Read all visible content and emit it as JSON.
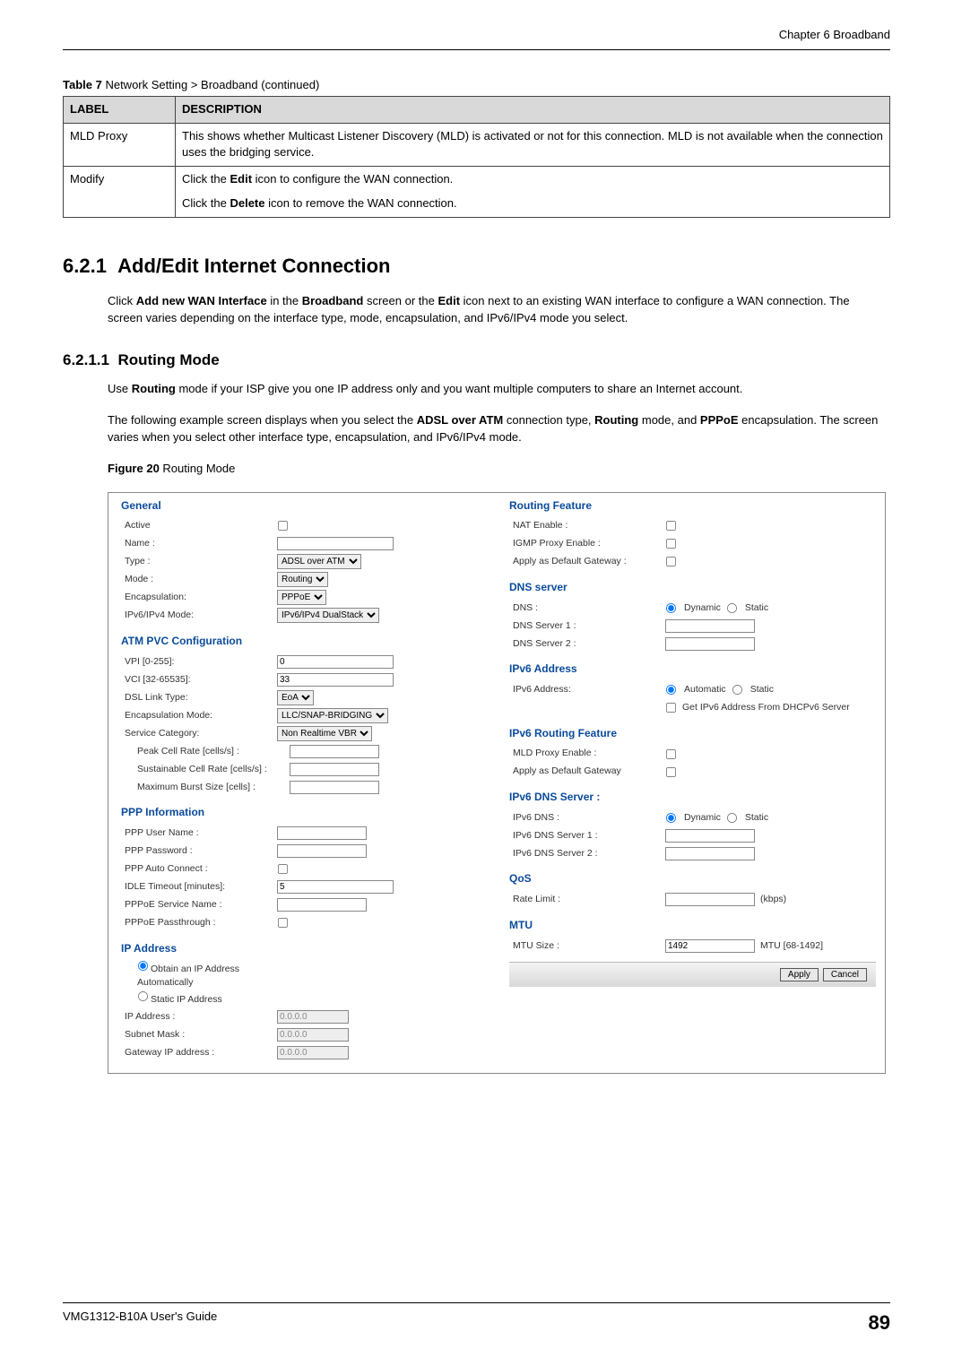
{
  "header": {
    "chapter": "Chapter 6 Broadband"
  },
  "table7": {
    "caption_bold": "Table 7",
    "caption_rest": "   Network Setting > Broadband (continued)",
    "head_label": "LABEL",
    "head_desc": "DESCRIPTION",
    "rows": [
      {
        "label": "MLD Proxy",
        "desc1": "This shows whether Multicast Listener Discovery (MLD) is activated or not for this connection. MLD is not available when the connection uses the bridging service."
      },
      {
        "label": "Modify",
        "desc1": "Click the Edit icon to configure the WAN connection.",
        "desc2": "Click the Delete icon to remove the WAN connection."
      }
    ]
  },
  "sec621": {
    "num": "6.2.1",
    "title": "Add/Edit Internet Connection",
    "para": "Click Add new WAN Interface in the Broadband screen or the Edit icon next to an existing WAN interface to configure a WAN connection. The screen varies depending on the interface type, mode, encapsulation, and IPv6/IPv4 mode you select."
  },
  "sec6211": {
    "num": "6.2.1.1",
    "title": "Routing Mode",
    "para1": "Use Routing mode if your ISP give you one IP address only and you want multiple computers to share an Internet account.",
    "para2": "The following example screen displays when you select the ADSL over ATM connection type, Routing mode, and PPPoE encapsulation. The screen varies when you select other interface type, encapsulation, and IPv6/IPv4 mode."
  },
  "figure": {
    "caption_bold": "Figure 20",
    "caption_rest": "   Routing Mode",
    "general": {
      "title": "General",
      "active": "Active",
      "name": "Name :",
      "type": "Type :",
      "type_v": "ADSL over ATM",
      "mode": "Mode :",
      "mode_v": "Routing",
      "encap": "Encapsulation:",
      "encap_v": "PPPoE",
      "ipmode": "IPv6/IPv4 Mode:",
      "ipmode_v": "IPv6/IPv4 DualStack"
    },
    "atm": {
      "title": "ATM PVC Configuration",
      "vpi": "VPI [0-255]:",
      "vpi_v": "0",
      "vci": "VCI [32-65535]:",
      "vci_v": "33",
      "link": "DSL Link Type:",
      "link_v": "EoA",
      "encmode": "Encapsulation Mode:",
      "encmode_v": "LLC/SNAP-BRIDGING",
      "service": "Service Category:",
      "service_v": "Non Realtime VBR",
      "peak": "Peak Cell Rate [cells/s] :",
      "sustain": "Sustainable Cell Rate [cells/s] :",
      "burst": "Maximum Burst Size [cells] :"
    },
    "ppp": {
      "title": "PPP Information",
      "user": "PPP User Name :",
      "pass": "PPP Password :",
      "auto": "PPP Auto Connect :",
      "idle": "IDLE Timeout [minutes]:",
      "idle_v": "5",
      "svcname": "PPPoE Service Name :",
      "pass_th": "PPPoE Passthrough :"
    },
    "ipaddr": {
      "title": "IP Address",
      "opt_auto": "Obtain an IP Address Automatically",
      "opt_static": "Static IP Address",
      "ip": "IP Address :",
      "ip_v": "0.0.0.0",
      "subnet": "Subnet Mask :",
      "subnet_v": "0.0.0.0",
      "gw": "Gateway IP address :",
      "gw_v": "0.0.0.0"
    },
    "route": {
      "title": "Routing Feature",
      "nat": "NAT Enable :",
      "igmp": "IGMP Proxy Enable :",
      "defgw": "Apply as Default Gateway :"
    },
    "dns": {
      "title": "DNS server",
      "dns": "DNS :",
      "dyn": "Dynamic",
      "stat": "Static",
      "d1": "DNS Server 1 :",
      "d2": "DNS Server 2 :"
    },
    "v6addr": {
      "title": "IPv6 Address",
      "addr": "IPv6 Address:",
      "auto": "Automatic",
      "stat": "Static",
      "dhcp": "Get IPv6 Address From DHCPv6 Server"
    },
    "v6route": {
      "title": "IPv6 Routing Feature",
      "mld": "MLD Proxy Enable :",
      "defgw": "Apply as Default Gateway"
    },
    "v6dns": {
      "title": "IPv6 DNS Server :",
      "dns": "IPv6 DNS :",
      "dyn": "Dynamic",
      "stat": "Static",
      "d1": "IPv6 DNS Server 1 :",
      "d2": "IPv6 DNS Server 2 :"
    },
    "qos": {
      "title": "QoS",
      "rate": "Rate Limit :",
      "unit": "(kbps)"
    },
    "mtu": {
      "title": "MTU",
      "size": "MTU Size :",
      "size_v": "1492",
      "range": "MTU [68-1492]"
    },
    "btn_apply": "Apply",
    "btn_cancel": "Cancel"
  },
  "footer": {
    "guide": "VMG1312-B10A User's Guide",
    "page": "89"
  }
}
